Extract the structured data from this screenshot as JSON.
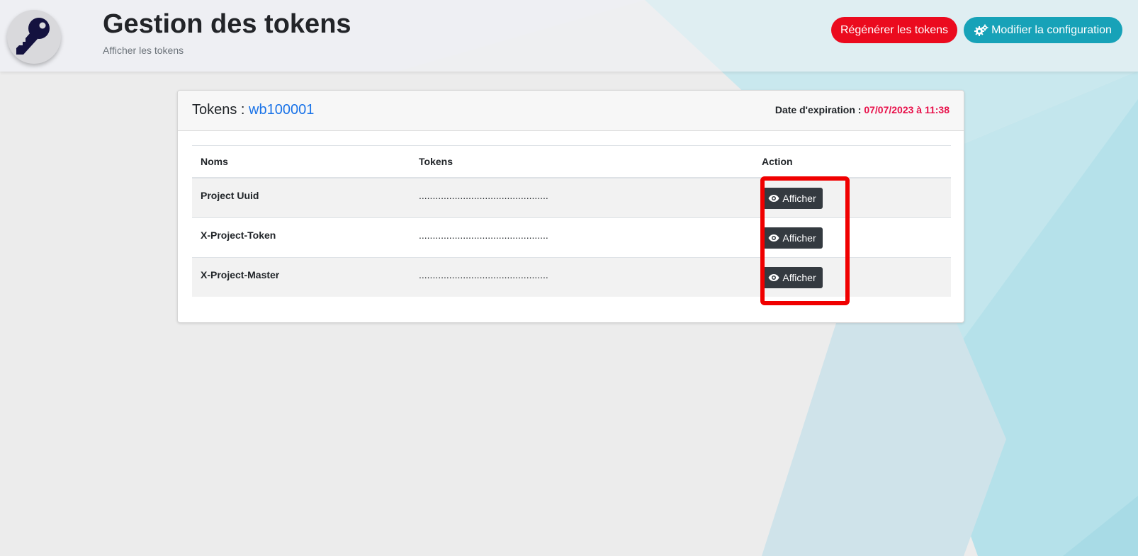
{
  "header": {
    "title": "Gestion des tokens",
    "subtitle": "Afficher les tokens",
    "logo_icon": "key-icon",
    "regen_button": "Régénérer les tokens",
    "config_button": "Modifier la configuration",
    "config_icon": "gears-icon"
  },
  "card": {
    "title_prefix": "Tokens : ",
    "project_id": "wb100001",
    "expiry_label": "Date d'expiration : ",
    "expiry_value": "07/07/2023 à 11:38"
  },
  "table": {
    "headers": [
      "Noms",
      "Tokens",
      "Action"
    ],
    "rows": [
      {
        "name": "Project Uuid",
        "token": "...............................................",
        "action": "Afficher"
      },
      {
        "name": "X-Project-Token",
        "token": "...............................................",
        "action": "Afficher"
      },
      {
        "name": "X-Project-Master",
        "token": "...............................................",
        "action": "Afficher"
      }
    ]
  },
  "colors": {
    "accent_red": "#eb0a1e",
    "accent_teal": "#17a2b8",
    "link_blue": "#1a73e8",
    "expiry_red": "#e8104a",
    "dark_button": "#343a40",
    "highlight_red": "#f00000"
  }
}
